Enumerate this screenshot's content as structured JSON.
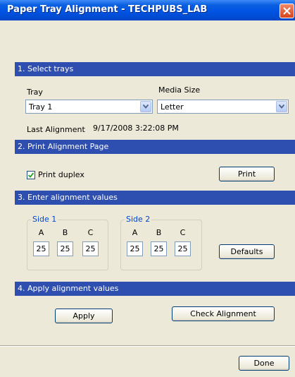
{
  "window": {
    "title": "Paper Tray Alignment - TECHPUBS_LAB",
    "close_icon": "close-icon"
  },
  "section1": {
    "header": "1. Select trays",
    "tray_label": "Tray",
    "tray_value": "Tray 1",
    "media_label": "Media Size",
    "media_value": "Letter",
    "last_alignment_label": "Last Alignment",
    "last_alignment_value": "9/17/2008 3:22:08 PM"
  },
  "section2": {
    "header": "2. Print Alignment Page",
    "duplex_label": "Print duplex",
    "duplex_checked": true,
    "print_button": "Print"
  },
  "section3": {
    "header": "3. Enter alignment values",
    "side1": {
      "title": "Side 1",
      "columns": [
        "A",
        "B",
        "C"
      ],
      "values": [
        "25",
        "25",
        "25"
      ]
    },
    "side2": {
      "title": "Side 2",
      "columns": [
        "A",
        "B",
        "C"
      ],
      "values": [
        "25",
        "25",
        "25"
      ]
    },
    "defaults_button": "Defaults"
  },
  "section4": {
    "header": "4. Apply alignment values",
    "apply_button": "Apply",
    "check_button": "Check Alignment"
  },
  "footer": {
    "done_button": "Done"
  },
  "colors": {
    "titlebar": "#0054e3",
    "section_header": "#2f4fb0",
    "dialog_bg": "#ece9d8",
    "group_title": "#0046d5"
  }
}
